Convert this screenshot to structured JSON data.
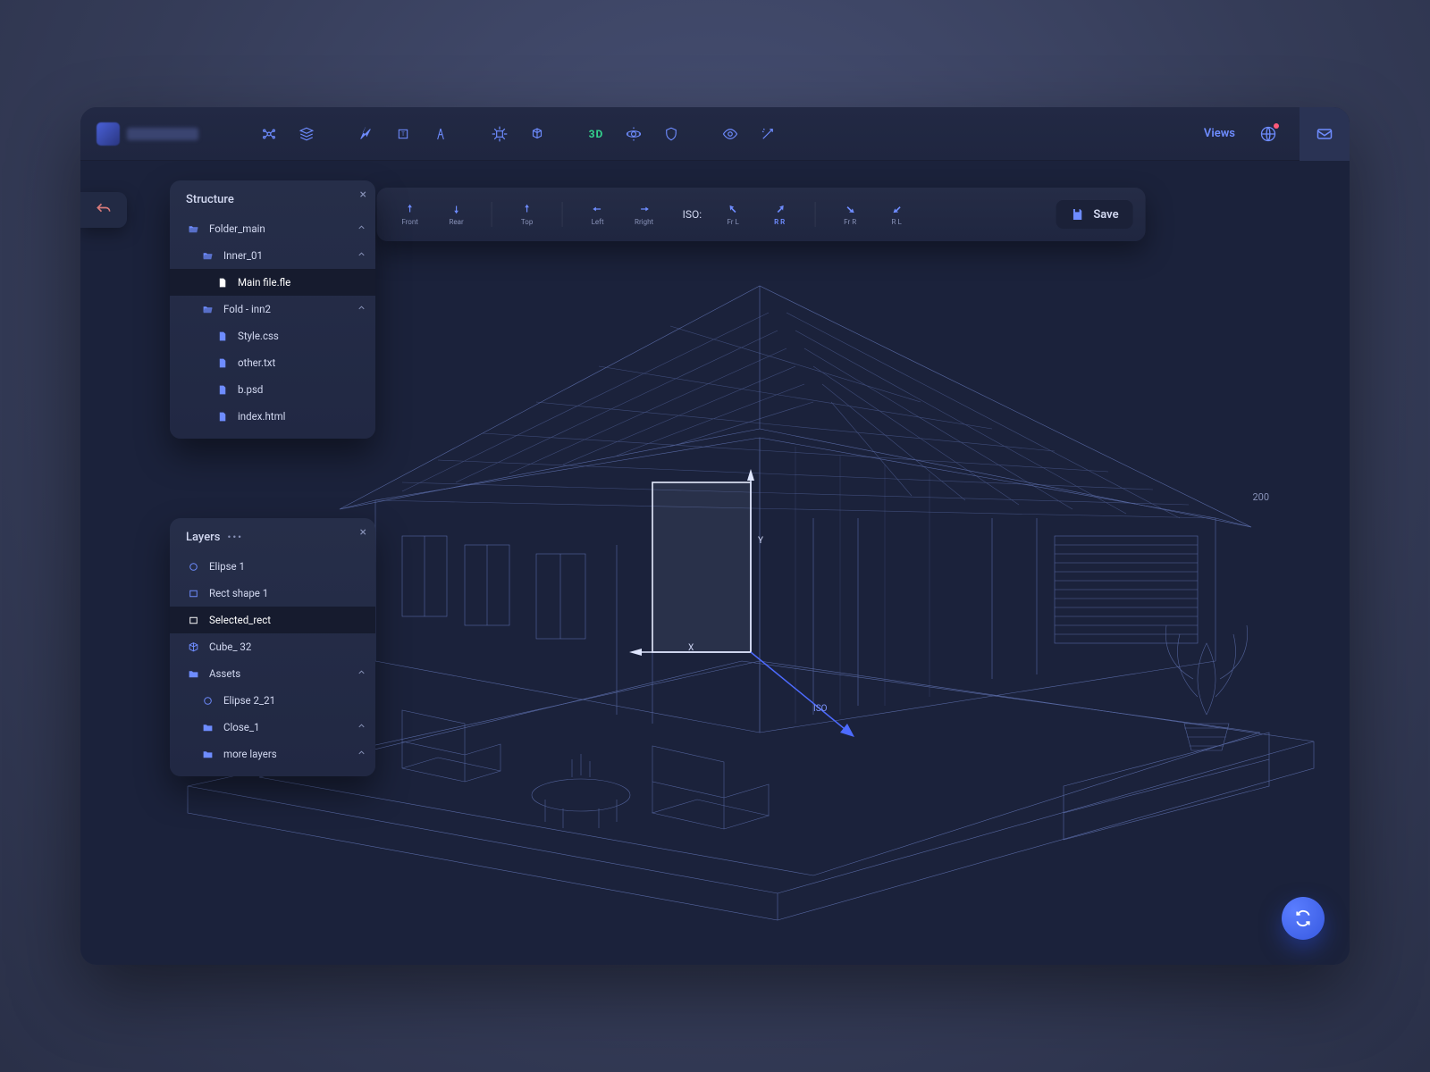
{
  "app": {
    "views_label": "Views"
  },
  "toolbar": {
    "groups": [
      [
        "node",
        "stack"
      ],
      [
        "pointer",
        "artboard",
        "compass"
      ],
      [
        "transform",
        "cube-rot"
      ],
      [
        "3d",
        "orbit",
        "shield"
      ],
      [
        "eye",
        "wand"
      ]
    ]
  },
  "float": {
    "items": [
      {
        "id": "front",
        "label": "Front"
      },
      {
        "id": "rear",
        "label": "Rear"
      },
      {
        "id": "sep"
      },
      {
        "id": "top",
        "label": "Top"
      },
      {
        "id": "sep"
      },
      {
        "id": "left",
        "label": "Left"
      },
      {
        "id": "right",
        "label": "Rright"
      }
    ],
    "iso_label": "ISO:",
    "iso_items": [
      {
        "id": "frl",
        "label": "Fr L"
      },
      {
        "id": "rr",
        "label": "R R",
        "active": true
      },
      {
        "id": "sep"
      },
      {
        "id": "frr",
        "label": "Fr R"
      },
      {
        "id": "rl",
        "label": "R L"
      }
    ],
    "save": "Save"
  },
  "structure": {
    "title": "Structure",
    "tree": [
      {
        "type": "folder",
        "label": "Folder_main",
        "indent": 0,
        "open": true
      },
      {
        "type": "folder",
        "label": "Inner_01",
        "indent": 1,
        "open": true
      },
      {
        "type": "file",
        "label": "Main file.fle",
        "indent": 2,
        "selected": true
      },
      {
        "type": "folder",
        "label": "Fold - inn2",
        "indent": 1,
        "open": true
      },
      {
        "type": "file",
        "label": "Style.css",
        "indent": 2
      },
      {
        "type": "file",
        "label": "other.txt",
        "indent": 2
      },
      {
        "type": "file",
        "label": "b.psd",
        "indent": 2
      },
      {
        "type": "file",
        "label": "index.html",
        "indent": 2
      }
    ]
  },
  "layers": {
    "title": "Layers",
    "items": [
      {
        "icon": "ellipse",
        "label": "Elipse 1"
      },
      {
        "icon": "rect",
        "label": "Rect shape 1"
      },
      {
        "icon": "rect",
        "label": "Selected_rect",
        "selected": true
      },
      {
        "icon": "cube",
        "label": "Cube_ 32"
      },
      {
        "icon": "folder",
        "label": "Assets",
        "open": true
      },
      {
        "icon": "ellipse",
        "label": "Elipse 2_21",
        "indent": 1
      },
      {
        "icon": "folder",
        "label": "Close_1",
        "indent": 1,
        "chev": true
      },
      {
        "icon": "folder",
        "label": "more layers",
        "indent": 1,
        "chev": true
      }
    ]
  },
  "viewport": {
    "room_label": "200",
    "axis_x": "X",
    "axis_y": "Y",
    "axis_iso": "ISO"
  }
}
